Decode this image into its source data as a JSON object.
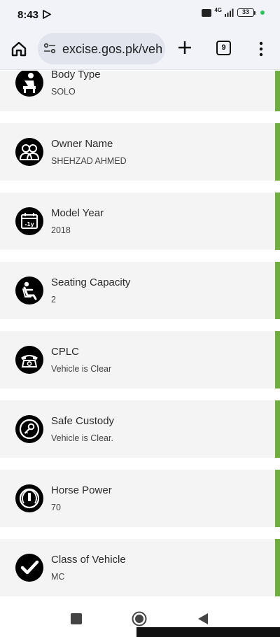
{
  "status_bar": {
    "time": "8:43",
    "network": "4G",
    "volte": "VoLTE",
    "battery": "33"
  },
  "browser": {
    "url": "excise.gos.pk/veh",
    "tab_count": "9"
  },
  "fields": [
    {
      "title": "Body Type",
      "value": "SOLO",
      "icon": "seated-person-icon"
    },
    {
      "title": "Owner Name",
      "value": "SHEHZAD AHMED",
      "icon": "owners-icon"
    },
    {
      "title": "Model Year",
      "value": "2018",
      "icon": "calendar-icon",
      "icon_text": "-1y"
    },
    {
      "title": "Seating Capacity",
      "value": "2",
      "icon": "car-seat-icon"
    },
    {
      "title": "CPLC",
      "value": "Vehicle is Clear",
      "icon": "telephone-icon"
    },
    {
      "title": "Safe Custody",
      "value": "Vehicle is Clear.",
      "icon": "key-icon"
    },
    {
      "title": "Horse Power",
      "value": "70",
      "icon": "power-gauge-icon"
    },
    {
      "title": "Class of Vehicle",
      "value": "MC",
      "icon": "checkmark-icon"
    }
  ],
  "colors": {
    "accent": "#6fae3e",
    "card_bg": "#f4f4f4"
  }
}
